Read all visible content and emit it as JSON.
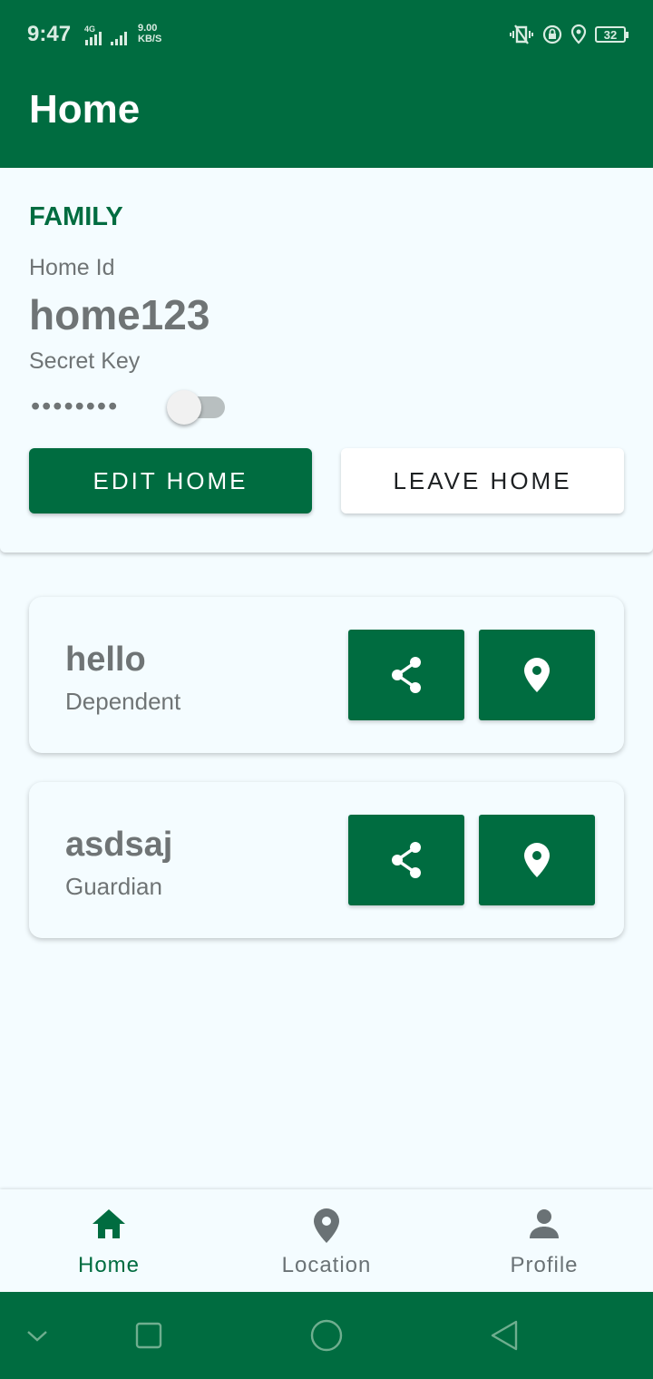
{
  "status_bar": {
    "time": "9:47",
    "network_type": "4G",
    "speed_value": "9.00",
    "speed_unit": "KB/S",
    "battery": "32",
    "icons": [
      "vibrate-icon",
      "lock-rotation-icon",
      "location-icon",
      "battery-icon"
    ]
  },
  "app_bar": {
    "title": "Home"
  },
  "family": {
    "section_title": "FAMILY",
    "home_id_label": "Home Id",
    "home_id": "home123",
    "secret_key_label": "Secret Key",
    "secret_key_masked": "••••••••",
    "show_secret_toggle": false,
    "edit_button": "EDIT HOME",
    "leave_button": "LEAVE HOME"
  },
  "members": [
    {
      "name": "hello",
      "role": "Dependent"
    },
    {
      "name": "asdsaj",
      "role": "Guardian"
    }
  ],
  "bottom_nav": {
    "items": [
      {
        "label": "Home",
        "icon": "home-icon",
        "active": true
      },
      {
        "label": "Location",
        "icon": "location-pin-icon",
        "active": false
      },
      {
        "label": "Profile",
        "icon": "person-icon",
        "active": false
      }
    ]
  },
  "colors": {
    "primary": "#006c40",
    "background": "#f4fcff",
    "text_muted": "#6f7475"
  }
}
